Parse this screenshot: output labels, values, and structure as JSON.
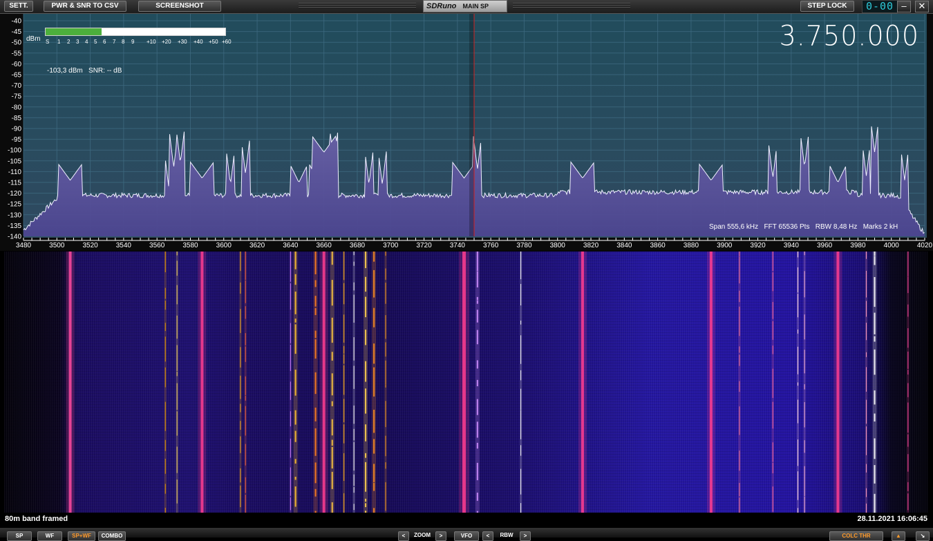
{
  "titlebar": {
    "settings_label": "SETT.",
    "pwr_snr_label": "PWR & SNR TO CSV",
    "screenshot_label": "SCREENSHOT",
    "brand": "SDRuno",
    "panel": "MAIN SP",
    "step_lock_label": "STEP LOCK",
    "lcd_value": "0-00",
    "minimize_icon": "minimize-icon",
    "close_icon": "close-icon"
  },
  "spectrum": {
    "dbm_unit": "dBm",
    "y_ticks": [
      "-40",
      "-45",
      "-50",
      "-55",
      "-60",
      "-65",
      "-70",
      "-75",
      "-80",
      "-85",
      "-90",
      "-95",
      "-100",
      "-105",
      "-110",
      "-115",
      "-120",
      "-125",
      "-130",
      "-135",
      "-140"
    ],
    "x_ticks": [
      "3480",
      "3500",
      "3520",
      "3540",
      "3560",
      "3580",
      "3600",
      "3620",
      "3640",
      "3660",
      "3680",
      "3700",
      "3720",
      "3740",
      "3760",
      "3780",
      "3800",
      "3820",
      "3840",
      "3860",
      "3880",
      "3900",
      "3920",
      "3940",
      "3960",
      "3980",
      "4000",
      "4020"
    ],
    "smeter_scale": [
      "S",
      "1",
      "2",
      "3",
      "4",
      "5",
      "6",
      "7",
      "8",
      "9",
      "+10",
      "+20",
      "+30",
      "+40",
      "+50",
      "+60"
    ],
    "smeter_level": 0.31,
    "signal_text": "-103,3 dBm   SNR: -- dB",
    "frequency": "3.750.000",
    "stats": "Span 555,6 kHz   FFT 65536 Pts   RBW 8,48 Hz   Marks 2 kH",
    "tuned_khz": 3750,
    "span_khz": [
      3480,
      4020
    ],
    "db_range": [
      -140,
      -40
    ],
    "noise_floor_db": -121,
    "peaks": [
      {
        "khz": 3508,
        "db": -114,
        "w": 3
      },
      {
        "khz": 3567,
        "db": -117,
        "w": 1
      },
      {
        "khz": 3570,
        "db": -108,
        "w": 1
      },
      {
        "khz": 3574,
        "db": -106,
        "w": 1
      },
      {
        "khz": 3587,
        "db": -113,
        "w": 3
      },
      {
        "khz": 3604,
        "db": -116,
        "w": 1
      },
      {
        "khz": 3613,
        "db": -111,
        "w": 1
      },
      {
        "khz": 3645,
        "db": -115,
        "w": 2
      },
      {
        "khz": 3656,
        "db": -114,
        "w": 2
      },
      {
        "khz": 3660,
        "db": -101,
        "w": 3
      },
      {
        "khz": 3666,
        "db": -106,
        "w": 1
      },
      {
        "khz": 3687,
        "db": -116,
        "w": 1
      },
      {
        "khz": 3695,
        "db": -116,
        "w": 1
      },
      {
        "khz": 3744,
        "db": -113,
        "w": 3
      },
      {
        "khz": 3752,
        "db": -109,
        "w": 1
      },
      {
        "khz": 3815,
        "db": -113,
        "w": 3
      },
      {
        "khz": 3892,
        "db": -114,
        "w": 3
      },
      {
        "khz": 3929,
        "db": -113,
        "w": 1
      },
      {
        "khz": 3948,
        "db": -108,
        "w": 1
      },
      {
        "khz": 3968,
        "db": -115,
        "w": 2
      },
      {
        "khz": 3985,
        "db": -112,
        "w": 1
      },
      {
        "khz": 3990,
        "db": -101,
        "w": 1
      },
      {
        "khz": 4008,
        "db": -114,
        "w": 1
      }
    ]
  },
  "waterfall": {
    "stripes": [
      {
        "khz": 3508,
        "color": "#ff4aa0",
        "w": 4
      },
      {
        "khz": 3565,
        "color": "#f0a000",
        "w": 1
      },
      {
        "khz": 3572,
        "color": "#ffe060",
        "w": 1
      },
      {
        "khz": 3587,
        "color": "#ff3d8f",
        "w": 4
      },
      {
        "khz": 3610,
        "color": "#ffb020",
        "w": 1
      },
      {
        "khz": 3613,
        "color": "#ff6a3c",
        "w": 1
      },
      {
        "khz": 3640,
        "color": "#d080ff",
        "w": 1
      },
      {
        "khz": 3643,
        "color": "#ffc030",
        "w": 2
      },
      {
        "khz": 3655,
        "color": "#ff8020",
        "w": 2
      },
      {
        "khz": 3660,
        "color": "#ff3d8f",
        "w": 4
      },
      {
        "khz": 3665,
        "color": "#ffc840",
        "w": 2
      },
      {
        "khz": 3672,
        "color": "#ffb020",
        "w": 1
      },
      {
        "khz": 3678,
        "color": "#ffffff",
        "w": 1
      },
      {
        "khz": 3685,
        "color": "#ffd050",
        "w": 2
      },
      {
        "khz": 3690,
        "color": "#ff9020",
        "w": 2
      },
      {
        "khz": 3697,
        "color": "#ffa020",
        "w": 1
      },
      {
        "khz": 3744,
        "color": "#ff3d8f",
        "w": 5
      },
      {
        "khz": 3752,
        "color": "#d090ff",
        "w": 2
      },
      {
        "khz": 3778,
        "color": "#ffffff",
        "w": 1
      },
      {
        "khz": 3815,
        "color": "#ff3d8f",
        "w": 4
      },
      {
        "khz": 3892,
        "color": "#ff3d8f",
        "w": 4
      },
      {
        "khz": 3909,
        "color": "#ff7a9a",
        "w": 1
      },
      {
        "khz": 3929,
        "color": "#ff6aa0",
        "w": 1
      },
      {
        "khz": 3944,
        "color": "#ffd8e8",
        "w": 1
      },
      {
        "khz": 3948,
        "color": "#ffb8d8",
        "w": 1
      },
      {
        "khz": 3968,
        "color": "#ff3d8f",
        "w": 4
      },
      {
        "khz": 3985,
        "color": "#ff9ac0",
        "w": 1
      },
      {
        "khz": 3990,
        "color": "#ffffff",
        "w": 2
      },
      {
        "khz": 4010,
        "color": "#ff4aa0",
        "w": 1
      }
    ]
  },
  "statusbar": {
    "preset": "80m band framed",
    "timestamp": "28.11.2021 16:06:45"
  },
  "bottombar": {
    "sp_label": "SP",
    "wf_label": "WF",
    "spwf_label": "SP+WF",
    "combo_label": "COMBO",
    "zoom_label": "ZOOM",
    "vfo_label": "VFO",
    "rbw_label": "RBW",
    "colour_label": "COLC THR"
  }
}
